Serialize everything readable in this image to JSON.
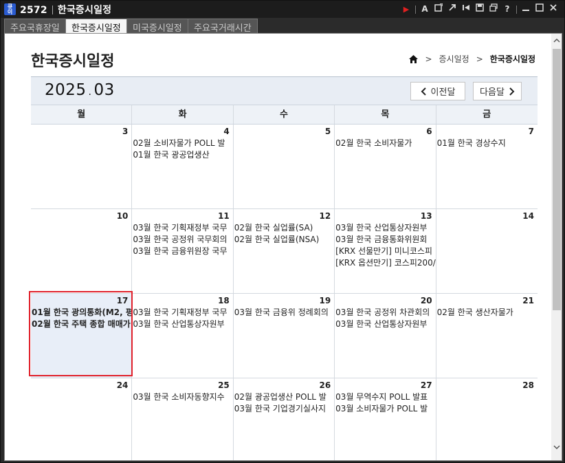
{
  "window": {
    "app_icon_text": [
      "큐",
      "이"
    ],
    "screen_number": "2572",
    "title": "한국증시일정"
  },
  "titlebar_tools": [
    "A",
    "?"
  ],
  "tabs": [
    {
      "label": "주요국휴장일",
      "active": false
    },
    {
      "label": "한국증시일정",
      "active": true
    },
    {
      "label": "미국증시일정",
      "active": false
    },
    {
      "label": "주요국거래시간",
      "active": false
    }
  ],
  "page": {
    "title": "한국증시일정",
    "breadcrumb": {
      "sep": ">",
      "parent": "증시일정",
      "current": "한국증시일정"
    }
  },
  "calendar": {
    "year": "2025",
    "month": "03",
    "prev_label": "이전달",
    "next_label": "다음달",
    "weekdays": [
      "월",
      "화",
      "수",
      "목",
      "금"
    ],
    "weeks": [
      [
        {
          "day": "3",
          "events": []
        },
        {
          "day": "4",
          "events": [
            "02월 소비자물가 POLL 발",
            "01월 한국 광공업생산"
          ]
        },
        {
          "day": "5",
          "events": []
        },
        {
          "day": "6",
          "events": [
            "02월 한국 소비자물가"
          ]
        },
        {
          "day": "7",
          "events": [
            "01월 한국 경상수지"
          ]
        }
      ],
      [
        {
          "day": "10",
          "events": []
        },
        {
          "day": "11",
          "events": [
            "03월 한국 기획재정부 국무",
            "03월 한국 공정위 국무회의",
            "03월 한국 금융위원장 국무"
          ]
        },
        {
          "day": "12",
          "events": [
            "02월 한국 실업률(SA)",
            "02월 한국 실업률(NSA)"
          ]
        },
        {
          "day": "13",
          "events": [
            "03월 한국 산업통상자원부",
            "03월 한국 금융통화위원회",
            "[KRX 선물만기] 미니코스피",
            "[KRX 옵션만기] 코스피200/"
          ]
        },
        {
          "day": "14",
          "events": []
        }
      ],
      [
        {
          "day": "17",
          "events": [
            "01월 한국 광의통화(M2, 평",
            "02월 한국 주택 종합 매매가"
          ],
          "selected": true
        },
        {
          "day": "18",
          "events": [
            "03월 한국 기획재정부 국무",
            "03월 한국 산업통상자원부"
          ]
        },
        {
          "day": "19",
          "events": [
            "03월 한국 금융위 정례회의"
          ]
        },
        {
          "day": "20",
          "events": [
            "03월 한국 공정위 차관회의",
            "03월 한국 산업통상자원부"
          ]
        },
        {
          "day": "21",
          "events": [
            "02월 한국 생산자물가"
          ]
        }
      ],
      [
        {
          "day": "24",
          "events": []
        },
        {
          "day": "25",
          "events": [
            "03월 한국 소비자동향지수"
          ]
        },
        {
          "day": "26",
          "events": [
            "02월 광공업생산 POLL 발",
            "03월 한국 기업경기실사지"
          ]
        },
        {
          "day": "27",
          "events": [
            "03월 무역수지 POLL 발표",
            "03월 소비자물가 POLL 발"
          ]
        },
        {
          "day": "28",
          "events": []
        }
      ]
    ]
  },
  "colors": {
    "titlebar_bg": "#1c1c1c",
    "calendar_header_bg": "#e8edf4",
    "selection_border": "#e0202a",
    "selected_cell_bg": "#e8eef8"
  }
}
